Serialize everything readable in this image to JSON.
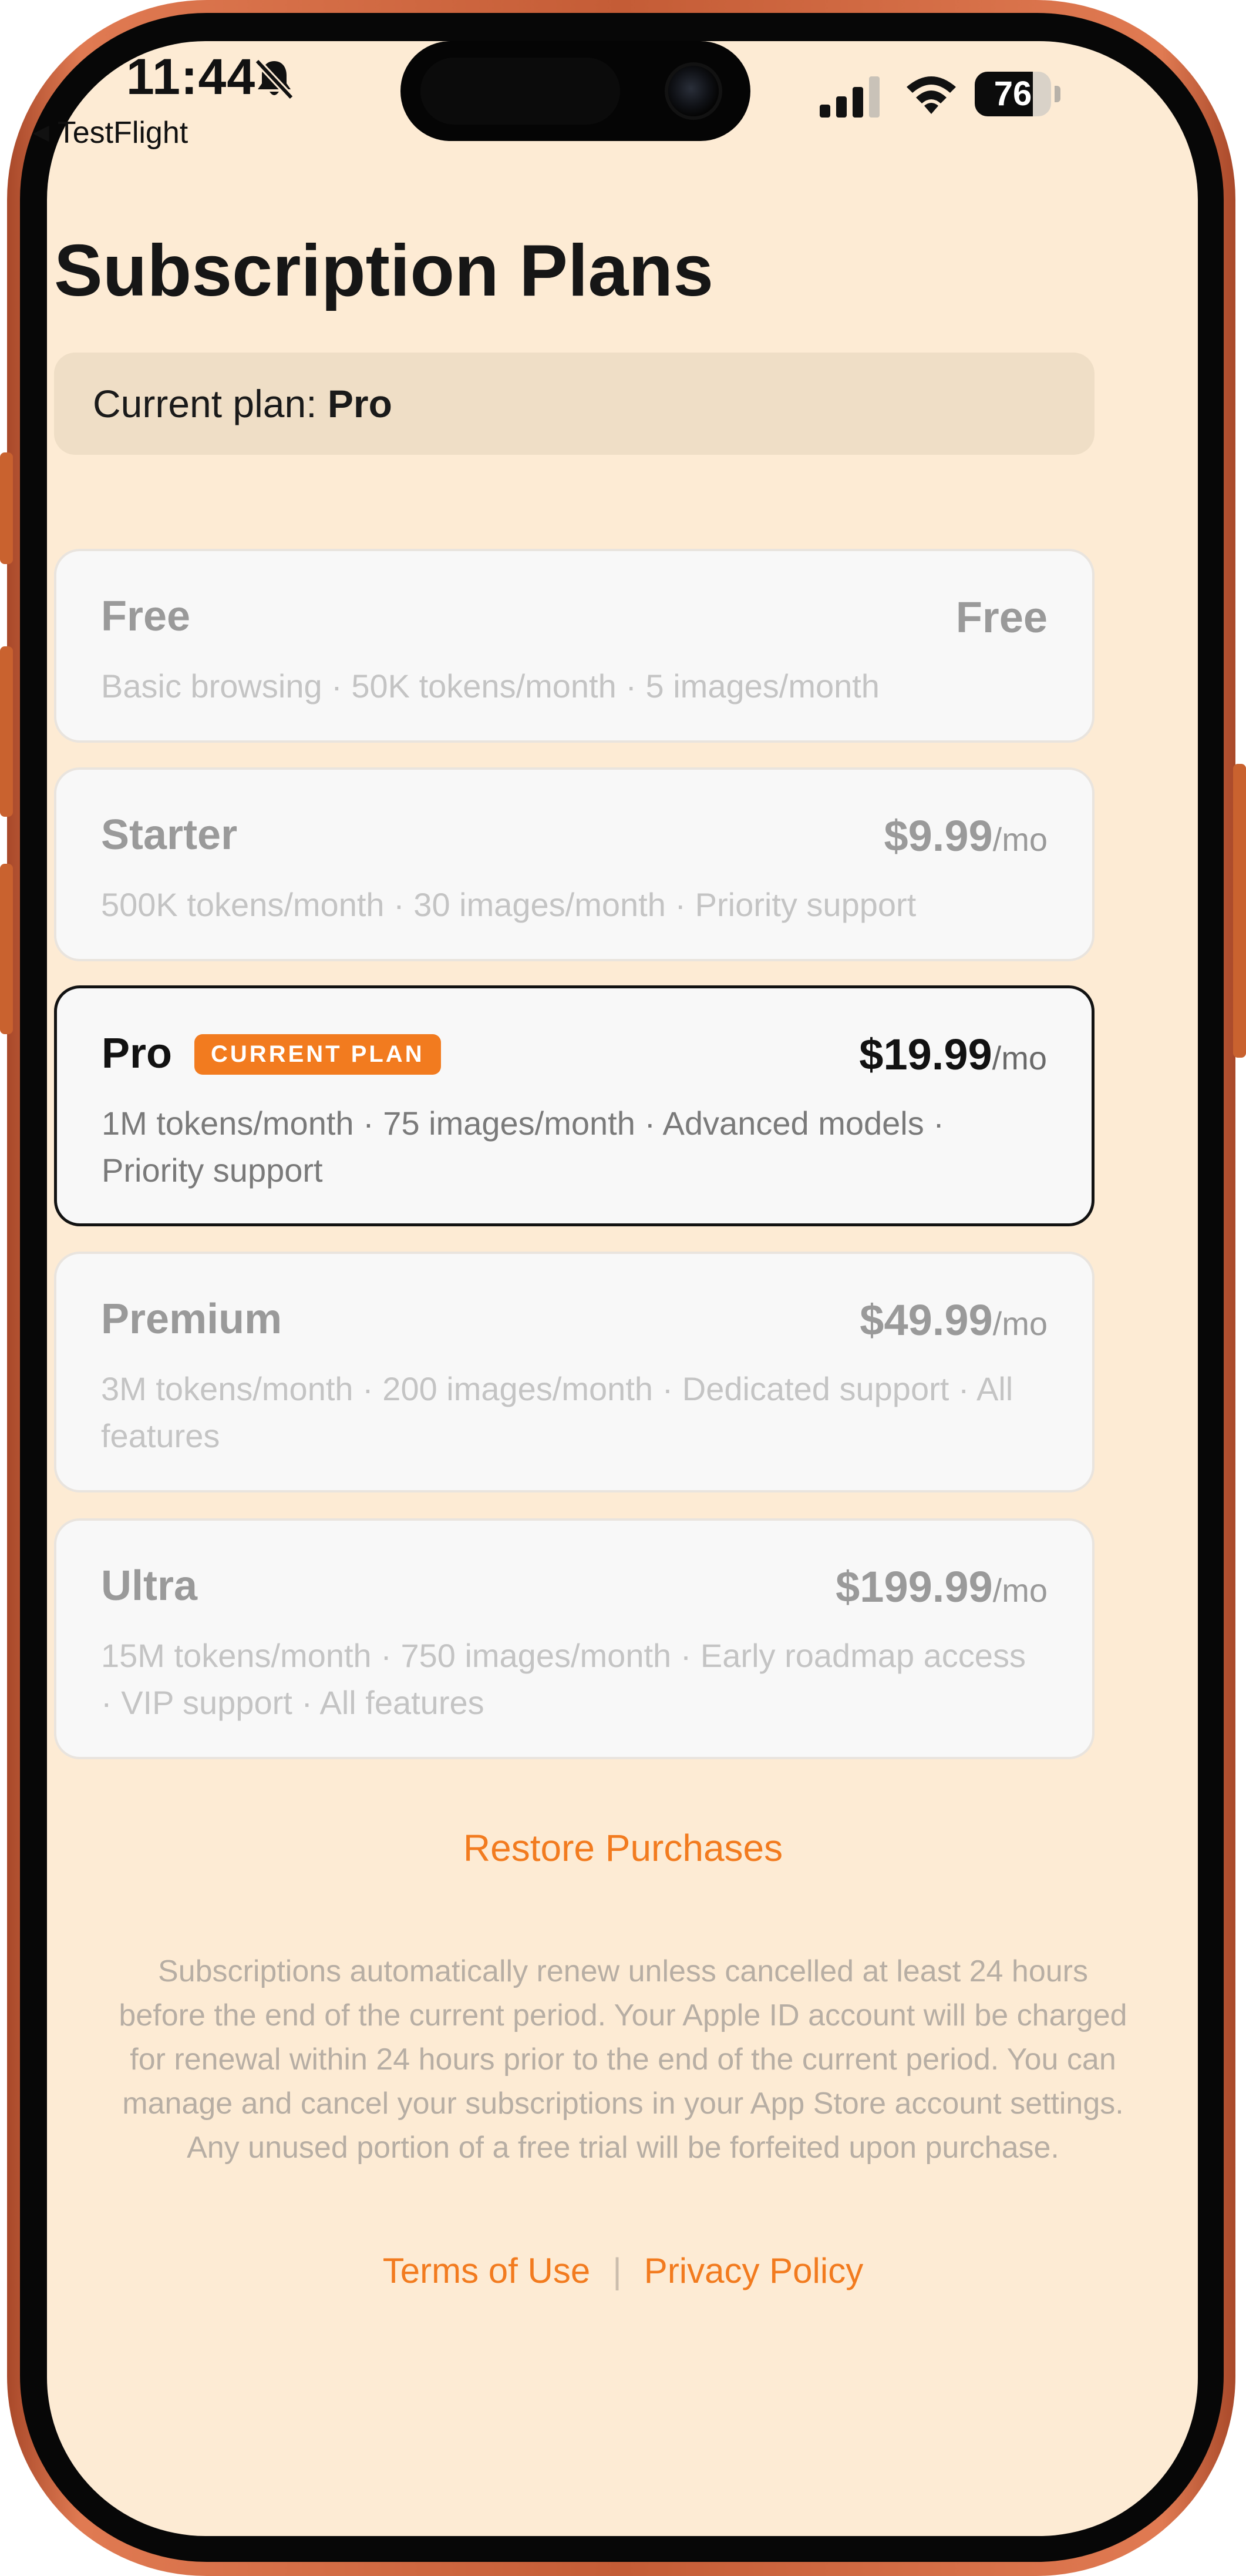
{
  "status_bar": {
    "time": "11:44",
    "back_app": "TestFlight",
    "battery_level": "76",
    "icons": [
      "bell-slash-icon",
      "signal-icon",
      "wifi-icon",
      "battery-icon"
    ]
  },
  "page": {
    "title": "Subscription Plans",
    "current_plan_prefix": "Current plan: ",
    "current_plan_value": "Pro"
  },
  "plans": [
    {
      "name": "Free",
      "price": "Free",
      "per": "",
      "description": "Basic browsing · 50K tokens/month · 5 images/month"
    },
    {
      "name": "Starter",
      "price": "$9.99",
      "per": "/mo",
      "description": "500K tokens/month · 30 images/month · Priority support"
    },
    {
      "name": "Pro",
      "badge": "CURRENT PLAN",
      "price": "$19.99",
      "per": "/mo",
      "description": "1M tokens/month · 75 images/month · Advanced models · Priority support"
    },
    {
      "name": "Premium",
      "price": "$49.99",
      "per": "/mo",
      "description": "3M tokens/month · 200 images/month · Dedicated support · All features"
    },
    {
      "name": "Ultra",
      "price": "$199.99",
      "per": "/mo",
      "description": "15M tokens/month · 750 images/month · Early roadmap access · VIP support · All features"
    }
  ],
  "restore_label": "Restore Purchases",
  "legal_text": "Subscriptions automatically renew unless cancelled at least 24 hours before the end of the current period. Your Apple ID account will be charged for renewal within 24 hours prior to the end of the current period. You can manage and cancel your subscriptions in your App Store account settings. Any unused portion of a free trial will be forfeited upon purchase.",
  "links": {
    "terms": "Terms of Use",
    "separator": "|",
    "privacy": "Privacy Policy"
  },
  "colors": {
    "accent": "#f27b1f",
    "background": "#fdebd4",
    "frame": "#c45c36"
  }
}
